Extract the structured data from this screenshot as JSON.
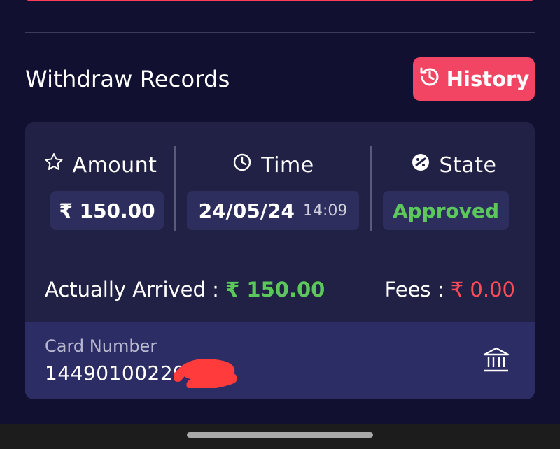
{
  "section": {
    "title": "Withdraw Records",
    "history_label": "History"
  },
  "record": {
    "amount_label": "Amount",
    "time_label": "Time",
    "state_label": "State",
    "amount_value": "₹ 150.00",
    "date_value": "24/05/24",
    "time_value": "14:09",
    "state_value": "Approved",
    "arrived_label": "Actually Arrived :",
    "arrived_value": "₹ 150.00",
    "fees_label": "Fees :",
    "fees_value": "₹ 0.00",
    "card_label": "Card Number",
    "card_number": "14490100229"
  },
  "icons": {
    "history": "history-icon",
    "amount": "star-icon",
    "time": "clock-icon",
    "state": "state-icon",
    "bank": "bank-icon"
  },
  "colors": {
    "background": "#111030",
    "card": "#212145",
    "accent": "#f24463",
    "green": "#5cc85c",
    "red": "#ff4a5a"
  }
}
